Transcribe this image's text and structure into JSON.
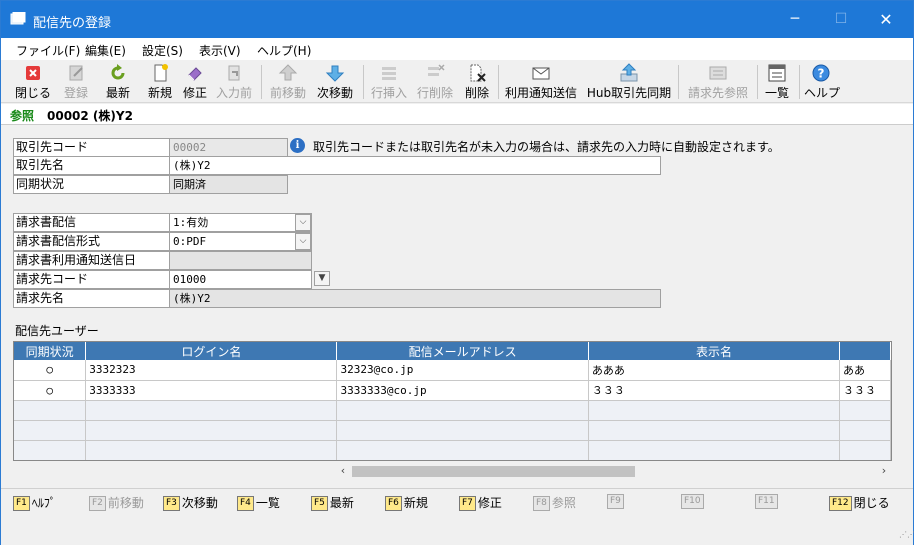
{
  "window": {
    "title": "配信先の登録"
  },
  "menu": [
    "ファイル(F)",
    "編集(E)",
    "設定(S)",
    "表示(V)",
    "ヘルプ(H)"
  ],
  "toolbar": {
    "close": "閉じる",
    "register": "登録",
    "latest": "最新",
    "new": "新規",
    "edit": "修正",
    "prev_input": "入力前",
    "prev_move": "前移動",
    "next_move": "次移動",
    "insert_row": "行挿入",
    "delete_row": "行削除",
    "delete": "削除",
    "send_notice": "利用通知送信",
    "hub_sync": "Hub取引先同期",
    "billing_ref": "請求先参照",
    "list": "一覧",
    "help": "ヘルプ"
  },
  "mode": {
    "label": "参照",
    "record": "00002 (株)Y2"
  },
  "form": {
    "partner_code_label": "取引先コード",
    "partner_code": "00002",
    "info_text": "取引先コードまたは取引先名が未入力の場合は、請求先の入力時に自動設定されます。",
    "partner_name_label": "取引先名",
    "partner_name": "(株)Y2",
    "sync_status_label": "同期状況",
    "sync_status": "同期済",
    "invoice_delivery_label": "請求書配信",
    "invoice_delivery": "1:有効",
    "invoice_format_label": "請求書配信形式",
    "invoice_format": "0:PDF",
    "notice_date_label": "請求書利用通知送信日",
    "notice_date": "",
    "billing_code_label": "請求先コード",
    "billing_code": "01000",
    "billing_name_label": "請求先名",
    "billing_name": "(株)Y2"
  },
  "users": {
    "title": "配信先ユーザー",
    "columns": [
      "同期状況",
      "ログイン名",
      "配信メールアドレス",
      "表示名",
      ""
    ],
    "rows": [
      [
        "○",
        "3332323",
        "32323@co.jp",
        "あああ",
        "ああ"
      ],
      [
        "○",
        "3333333",
        "3333333@co.jp",
        "３３３",
        "３３３"
      ]
    ]
  },
  "fkeys": {
    "f1": {
      "key": "F1",
      "label": "ﾍﾙﾌﾟ"
    },
    "f2": {
      "key": "F2",
      "label": "前移動"
    },
    "f3": {
      "key": "F3",
      "label": "次移動"
    },
    "f4": {
      "key": "F4",
      "label": "一覧"
    },
    "f5": {
      "key": "F5",
      "label": "最新"
    },
    "f6": {
      "key": "F6",
      "label": "新規"
    },
    "f7": {
      "key": "F7",
      "label": "修正"
    },
    "f8": {
      "key": "F8",
      "label": "参照"
    },
    "f9": {
      "key": "F9",
      "label": ""
    },
    "f10": {
      "key": "F10",
      "label": ""
    },
    "f11": {
      "key": "F11",
      "label": ""
    },
    "f12": {
      "key": "F12",
      "label": "閉じる"
    }
  },
  "colors": {
    "titlebar": "#1e78d7",
    "grid_header": "#3e78b3",
    "mode": "#1a8a1a"
  }
}
